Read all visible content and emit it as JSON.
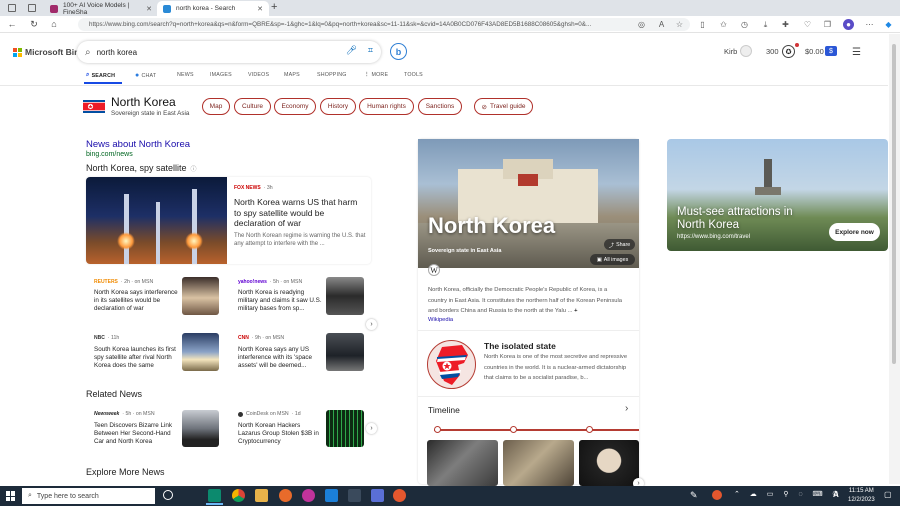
{
  "browser": {
    "tabs": [
      {
        "title": "100+ AI Voice Models | FineSha"
      },
      {
        "title": "north korea - Search"
      }
    ],
    "new_tab": "+",
    "url": "https://www.bing.com/search?q=north+korea&qs=n&form=QBRE&sp=-1&ghc=1&lq=0&pq=north+korea&sc=11-11&sk=&cvid=14A0B0CD076F43AD8ED5B1688C08605&ghsh=0&..."
  },
  "bing": {
    "logo_text": "Microsoft Bing",
    "query": "north korea",
    "user_name": "Kirb",
    "points": "300",
    "money": "$0.00",
    "money_badge": "$",
    "copilot_letter": "b",
    "scopes": [
      {
        "label": "SEARCH",
        "icon": "search-icon"
      },
      {
        "label": "CHAT",
        "icon": "chat-icon"
      },
      {
        "label": "NEWS"
      },
      {
        "label": "IMAGES"
      },
      {
        "label": "VIDEOS"
      },
      {
        "label": "MAPS"
      },
      {
        "label": "SHOPPING"
      },
      {
        "label": "MORE"
      },
      {
        "label": "TOOLS"
      }
    ]
  },
  "entity": {
    "title": "North Korea",
    "subtitle": "Sovereign state in East Asia",
    "pills": [
      "Map",
      "Culture",
      "Economy",
      "History",
      "Human rights",
      "Sanctions",
      "Travel guide"
    ]
  },
  "news": {
    "heading": "News about North Korea",
    "source": "bing.com/news",
    "section_title": "North Korea, spy satellite",
    "info_glyph": "ⓘ",
    "lead": {
      "source": "FOX NEWS",
      "age": "· 3h",
      "title": "North Korea warns US that harm to spy satellite would be declaration of war",
      "snippet": "The North Korean regime is warning the U.S. that any attempt to interfere with the ..."
    },
    "items": [
      {
        "source": "REUTERS",
        "meta": "· 2h · on MSN",
        "title": "North Korea says interference in its satellites would be declaration of war"
      },
      {
        "source": "yahoo!news",
        "meta": "· 5h · on MSN",
        "title": "North Korea is readying military and claims it saw U.S. military bases from sp..."
      },
      {
        "source": "NBC",
        "meta": "· 11h",
        "title": "South Korea launches its first spy satellite after rival North Korea does the same"
      },
      {
        "source": "CNN",
        "meta": "· 9h · on MSN",
        "title": "North Korea says any US interference with its 'space assets' will be deemed..."
      }
    ],
    "related_title": "Related News",
    "related": [
      {
        "source": "Newsweek",
        "meta": "· 5h · on MSN",
        "title": "Teen Discovers Bizarre Link Between Her Second-Hand Car and North Korea"
      },
      {
        "source": "CoinDesk on MSN",
        "meta": "· 1d",
        "title": "North Korean Hackers Lazarus Group Stolen $3B in Cryptocurrency"
      }
    ],
    "explore_title": "Explore More News"
  },
  "knowledge": {
    "name": "North Korea",
    "subtitle": "Sovereign state in East Asia",
    "share": "Share",
    "all_images": "All images",
    "wiki_glyph": "W",
    "description": "North Korea, officially the Democratic People's Republic of Korea, is a country in East Asia. It constitutes the northern half of the Korean Peninsula and borders China and Russia to the north at the Yalu ...",
    "more_glyph": "+",
    "wiki_link": "Wikipedia",
    "isolated_title": "The isolated state",
    "isolated_text": "North Korea is one of the most secretive and repressive countries in the world. It is a nuclear-armed dictatorship that claims to be a socialist paradise, b...",
    "timeline_title": "Timeline"
  },
  "attractions": {
    "title": "Must-see attractions in North Korea",
    "url": "https://www.bing.com/travel",
    "button": "Explore now"
  },
  "taskbar": {
    "search_placeholder": "Type here to search",
    "time": "11:15 AM",
    "date": "12/2/2023"
  },
  "colors": {
    "accent": "#174ae4",
    "pill_border": "#b0312b",
    "link": "#1a0dab",
    "url_green": "#006621",
    "taskbar": "#1d2b3a"
  }
}
